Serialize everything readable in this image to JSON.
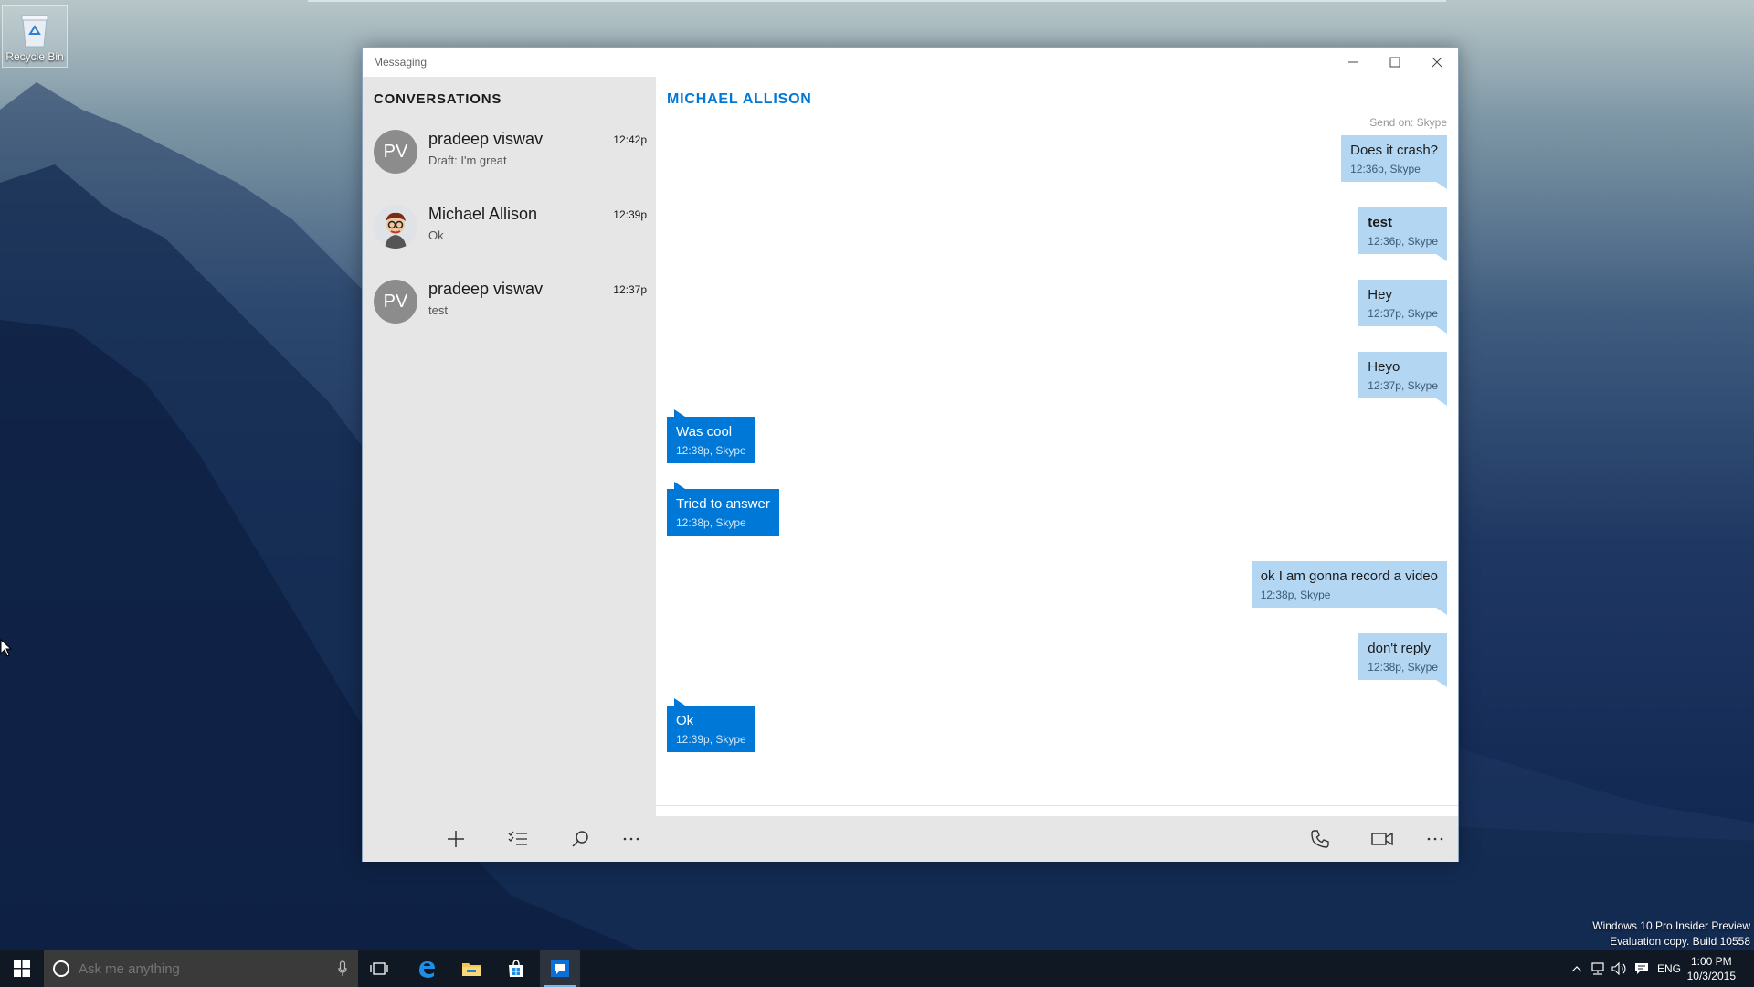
{
  "desktop": {
    "recycle_bin_label": "Recycle Bin",
    "watermark_line1": "Windows 10 Pro Insider Preview",
    "watermark_line2": "Evaluation copy. Build 10558"
  },
  "window": {
    "title": "Messaging",
    "controls": [
      "minimize-icon",
      "maximize-icon",
      "close-icon"
    ]
  },
  "sidebar": {
    "heading": "CONVERSATIONS",
    "conversations": [
      {
        "initials": "PV",
        "name": "pradeep viswav",
        "preview": "Draft: I'm great",
        "time": "12:42p"
      },
      {
        "initials": "",
        "name": "Michael Allison",
        "preview": "Ok",
        "time": "12:39p"
      },
      {
        "initials": "PV",
        "name": "pradeep viswav",
        "preview": "test",
        "time": "12:37p"
      }
    ]
  },
  "chat": {
    "contact_name": "MICHAEL ALLISON",
    "send_on": "Send on: Skype",
    "messages": [
      {
        "dir": "out",
        "text": "Does it crash?",
        "meta": "12:36p, Skype"
      },
      {
        "dir": "out",
        "text": "test",
        "meta": "12:36p, Skype",
        "bold": true
      },
      {
        "dir": "out",
        "text": "Hey",
        "meta": "12:37p, Skype"
      },
      {
        "dir": "out",
        "text": "Heyo",
        "meta": "12:37p, Skype"
      },
      {
        "dir": "in",
        "text": "Was cool",
        "meta": "12:38p, Skype"
      },
      {
        "dir": "in",
        "text": "Tried to answer",
        "meta": "12:38p, Skype"
      },
      {
        "dir": "out",
        "text": "ok I am gonna record a video",
        "meta": "12:38p, Skype"
      },
      {
        "dir": "out",
        "text": "don't reply",
        "meta": "12:38p, Skype"
      },
      {
        "dir": "in",
        "text": "Ok",
        "meta": "12:39p, Skype"
      }
    ],
    "composer": {
      "value": "",
      "placeholder": ""
    }
  },
  "appbar": {
    "left_icons": [
      "add-icon",
      "select-list-icon",
      "search-icon",
      "more-icon"
    ],
    "right_icons": [
      "call-icon",
      "video-call-icon",
      "more-icon"
    ]
  },
  "taskbar": {
    "search_placeholder": "Ask me anything",
    "language": "ENG",
    "time": "1:00 PM",
    "date": "10/3/2015"
  }
}
